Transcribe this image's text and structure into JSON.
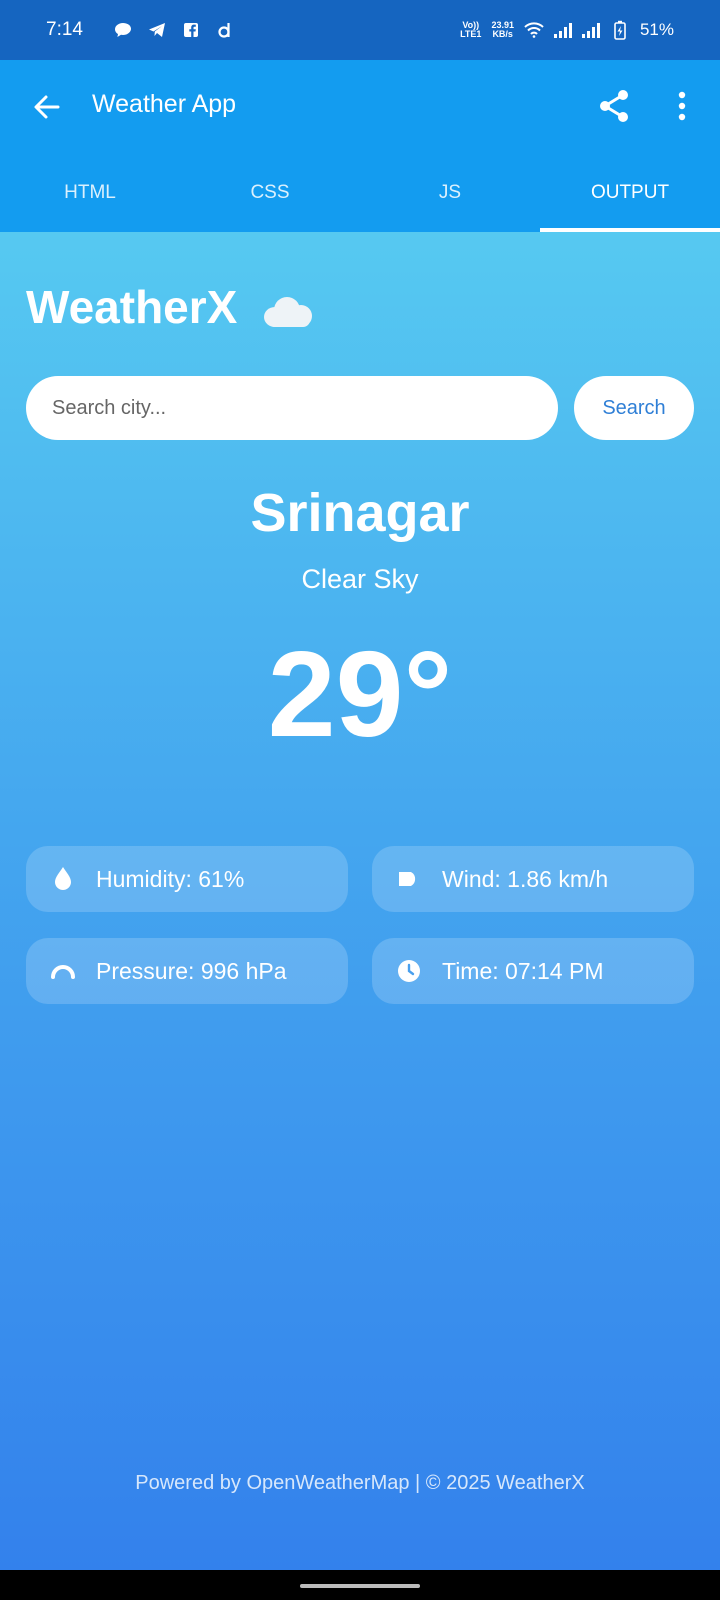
{
  "status_bar": {
    "time": "7:14",
    "net_speed_value": "23.91",
    "net_speed_unit": "KB/s",
    "volte_top": "Vo))",
    "volte_bottom": "LTE1",
    "battery": "51%"
  },
  "app_bar": {
    "title": "Weather App",
    "icons": [
      "back-arrow-icon",
      "share-icon",
      "more-vert-icon"
    ]
  },
  "tabs": [
    {
      "label": "HTML"
    },
    {
      "label": "CSS"
    },
    {
      "label": "JS"
    },
    {
      "label": "OUTPUT",
      "active": true
    }
  ],
  "weather": {
    "brand": "WeatherX",
    "search_placeholder": "Search city...",
    "search_button": "Search",
    "city": "Srinagar",
    "condition": "Clear Sky",
    "temperature": "29°",
    "details": [
      {
        "icon": "droplet-icon",
        "text": "Humidity: 61%"
      },
      {
        "icon": "wind-icon",
        "text": "Wind: 1.86 km/h"
      },
      {
        "icon": "gauge-icon",
        "text": "Pressure: 996 hPa"
      },
      {
        "icon": "clock-icon",
        "text": "Time: 07:14 PM"
      }
    ],
    "footer": "Powered by OpenWeatherMap | © 2025 WeatherX"
  },
  "colors": {
    "status_bar": "#1565c0",
    "app_bar": "#139cf0",
    "gradient_top": "#56c9f1",
    "gradient_bottom": "#3381ec",
    "search_button_text": "#2f7fd6"
  }
}
